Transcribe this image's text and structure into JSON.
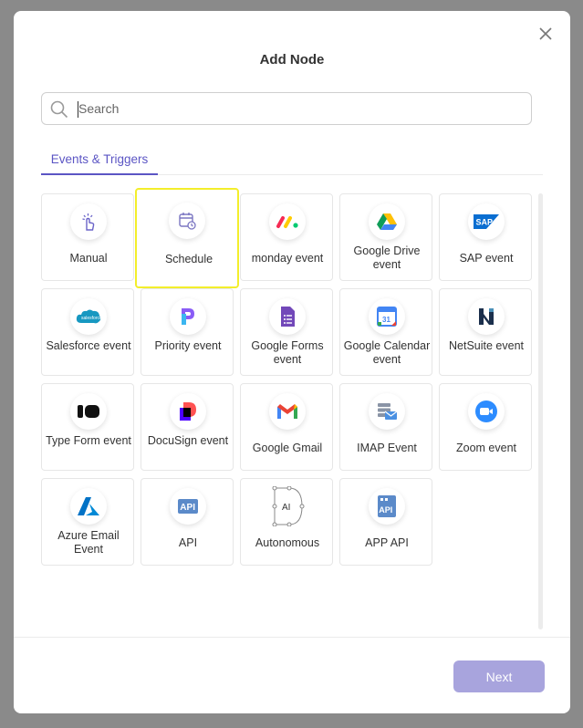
{
  "dialog": {
    "title": "Add Node",
    "search_placeholder": "Search",
    "search_value": "",
    "tab_label": "Events & Triggers",
    "next_label": "Next"
  },
  "nodes": [
    {
      "label": "Manual",
      "icon": "hand-pointer-icon"
    },
    {
      "label": "Schedule",
      "icon": "calendar-clock-icon",
      "selected": true
    },
    {
      "label": "monday event",
      "icon": "monday-logo-icon"
    },
    {
      "label": "Google Drive event",
      "icon": "google-drive-icon"
    },
    {
      "label": "SAP event",
      "icon": "sap-logo-icon"
    },
    {
      "label": "Salesforce event",
      "icon": "salesforce-cloud-icon"
    },
    {
      "label": "Priority event",
      "icon": "priority-logo-icon"
    },
    {
      "label": "Google Forms event",
      "icon": "google-forms-icon"
    },
    {
      "label": "Google Calendar event",
      "icon": "google-calendar-icon"
    },
    {
      "label": "NetSuite event",
      "icon": "netsuite-logo-icon"
    },
    {
      "label": "Type Form event",
      "icon": "typeform-logo-icon"
    },
    {
      "label": "DocuSign event",
      "icon": "docusign-logo-icon"
    },
    {
      "label": "Google Gmail",
      "icon": "gmail-icon"
    },
    {
      "label": "IMAP Event",
      "icon": "imap-mail-icon"
    },
    {
      "label": "Zoom event",
      "icon": "zoom-camera-icon"
    },
    {
      "label": "Azure Email Event",
      "icon": "azure-logo-icon"
    },
    {
      "label": "API",
      "icon": "api-badge-icon"
    },
    {
      "label": "Autonomous",
      "icon": "ai-node-icon"
    },
    {
      "label": "APP API",
      "icon": "app-api-icon"
    }
  ]
}
